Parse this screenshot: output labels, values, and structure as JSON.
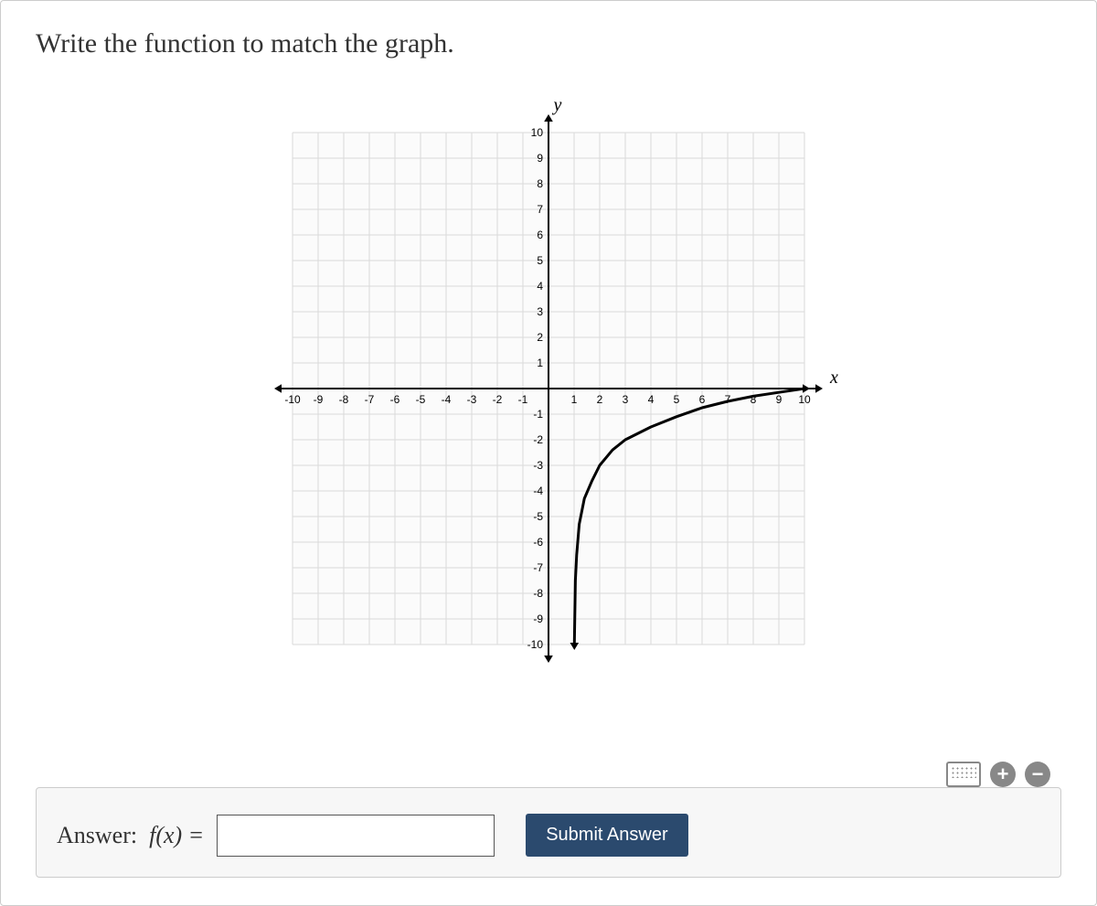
{
  "title": "Write the function to match the graph.",
  "chart_data": {
    "type": "line",
    "function_description": "logarithmic curve, vertical asymptote at x=1, passing through approximately (2,-3), (4,-1.5), (6,-0.75), (8,-0.3), (10,0)",
    "x": [
      1.01,
      1.05,
      1.1,
      1.2,
      1.4,
      1.7,
      2,
      2.5,
      3,
      4,
      5,
      6,
      7,
      8,
      9,
      10
    ],
    "y": [
      -10,
      -7.5,
      -6.5,
      -5.3,
      -4.3,
      -3.6,
      -3,
      -2.4,
      -2,
      -1.5,
      -1.1,
      -0.75,
      -0.5,
      -0.3,
      -0.15,
      0
    ],
    "xlabel": "x",
    "ylabel": "y",
    "xticks": [
      -10,
      -9,
      -8,
      -7,
      -6,
      -5,
      -4,
      -3,
      -2,
      -1,
      1,
      2,
      3,
      4,
      5,
      6,
      7,
      8,
      9,
      10
    ],
    "yticks": [
      -10,
      -9,
      -8,
      -7,
      -6,
      -5,
      -4,
      -3,
      -2,
      -1,
      1,
      2,
      3,
      4,
      5,
      6,
      7,
      8,
      9,
      10
    ],
    "xlim": [
      -10,
      10
    ],
    "ylim": [
      -10,
      10
    ],
    "grid": true
  },
  "answer": {
    "label_prefix": "Answer:",
    "fx": "f(x) =",
    "value": "",
    "submit": "Submit Answer"
  },
  "icons": {
    "plus": "+",
    "minus": "−"
  }
}
